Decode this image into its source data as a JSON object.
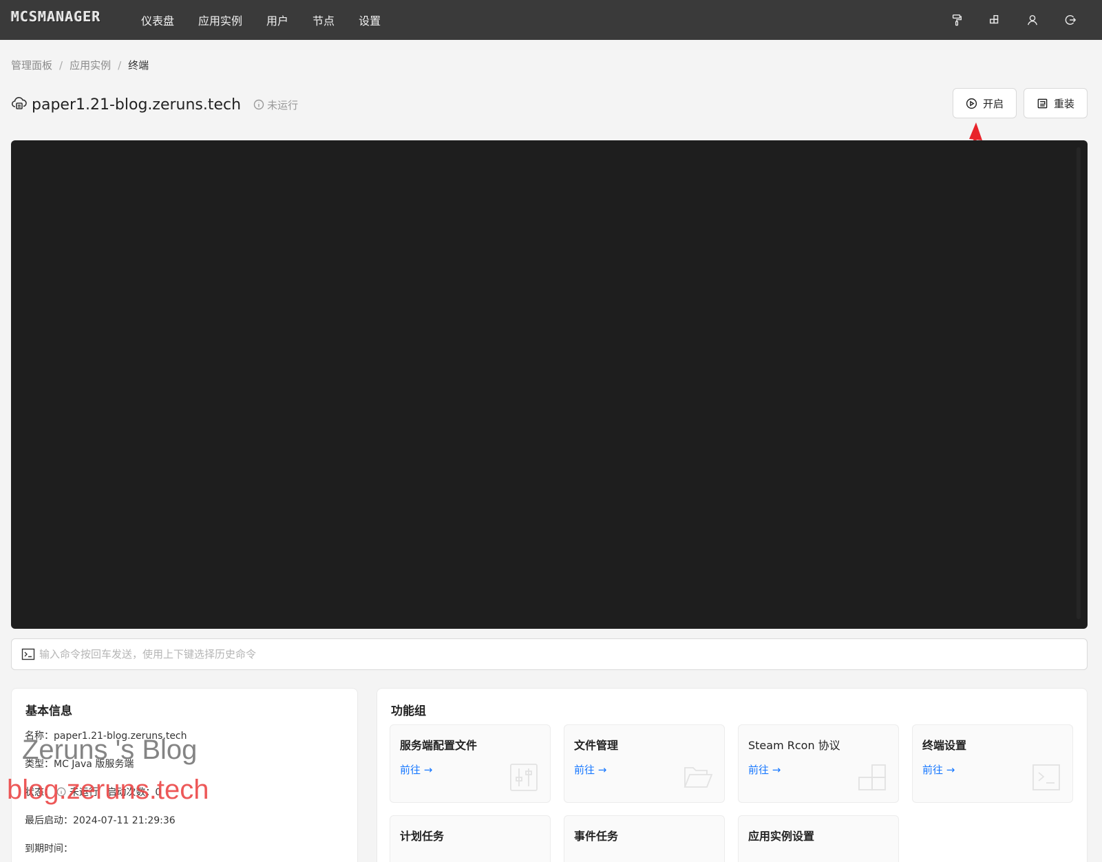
{
  "app": {
    "logo_text": "MCSMANAGER"
  },
  "nav": {
    "items": [
      {
        "label": "仪表盘"
      },
      {
        "label": "应用实例"
      },
      {
        "label": "用户"
      },
      {
        "label": "节点"
      },
      {
        "label": "设置"
      }
    ],
    "icons": [
      "paint-roller-icon",
      "blocks-icon",
      "user-icon",
      "logout-icon"
    ]
  },
  "breadcrumb": {
    "items": [
      "管理面板",
      "应用实例",
      "终端"
    ],
    "separator": "/"
  },
  "instance": {
    "name": "paper1.21-blog.zeruns.tech",
    "status": "未运行"
  },
  "actions": {
    "start_label": "开启",
    "reinstall_label": "重装"
  },
  "command": {
    "placeholder": "输入命令按回车发送，使用上下键选择历史命令"
  },
  "basic_info": {
    "title": "基本信息",
    "name_line": "名称：paper1.21-blog.zeruns.tech",
    "type_line": "类型：MC Java 版服务端",
    "status_prefix": "状态：",
    "status_value": "未运行",
    "start_count": "启动次数：0",
    "last_start": "最后启动：2024-07-11 21:29:36",
    "expire": "到期时间："
  },
  "watermark": {
    "line1": "Zeruns 's Blog",
    "line2": "blog.zeruns.tech"
  },
  "functions": {
    "title": "功能组",
    "go_label": "前往 →",
    "tiles": [
      {
        "title": "服务端配置文件",
        "icon": "sliders-icon"
      },
      {
        "title": "文件管理",
        "icon": "folder-open-icon"
      },
      {
        "title": "Steam Rcon 协议",
        "icon": "blocks-icon"
      },
      {
        "title": "终端设置",
        "icon": "terminal-icon"
      },
      {
        "title": "计划任务",
        "icon": ""
      },
      {
        "title": "事件任务",
        "icon": ""
      },
      {
        "title": "应用实例设置",
        "icon": ""
      }
    ]
  },
  "colors": {
    "topbar": "#3a3a3a",
    "terminal_bg": "#1e1e1e",
    "link": "#1677ff",
    "annotation_arrow": "#e8232a"
  }
}
